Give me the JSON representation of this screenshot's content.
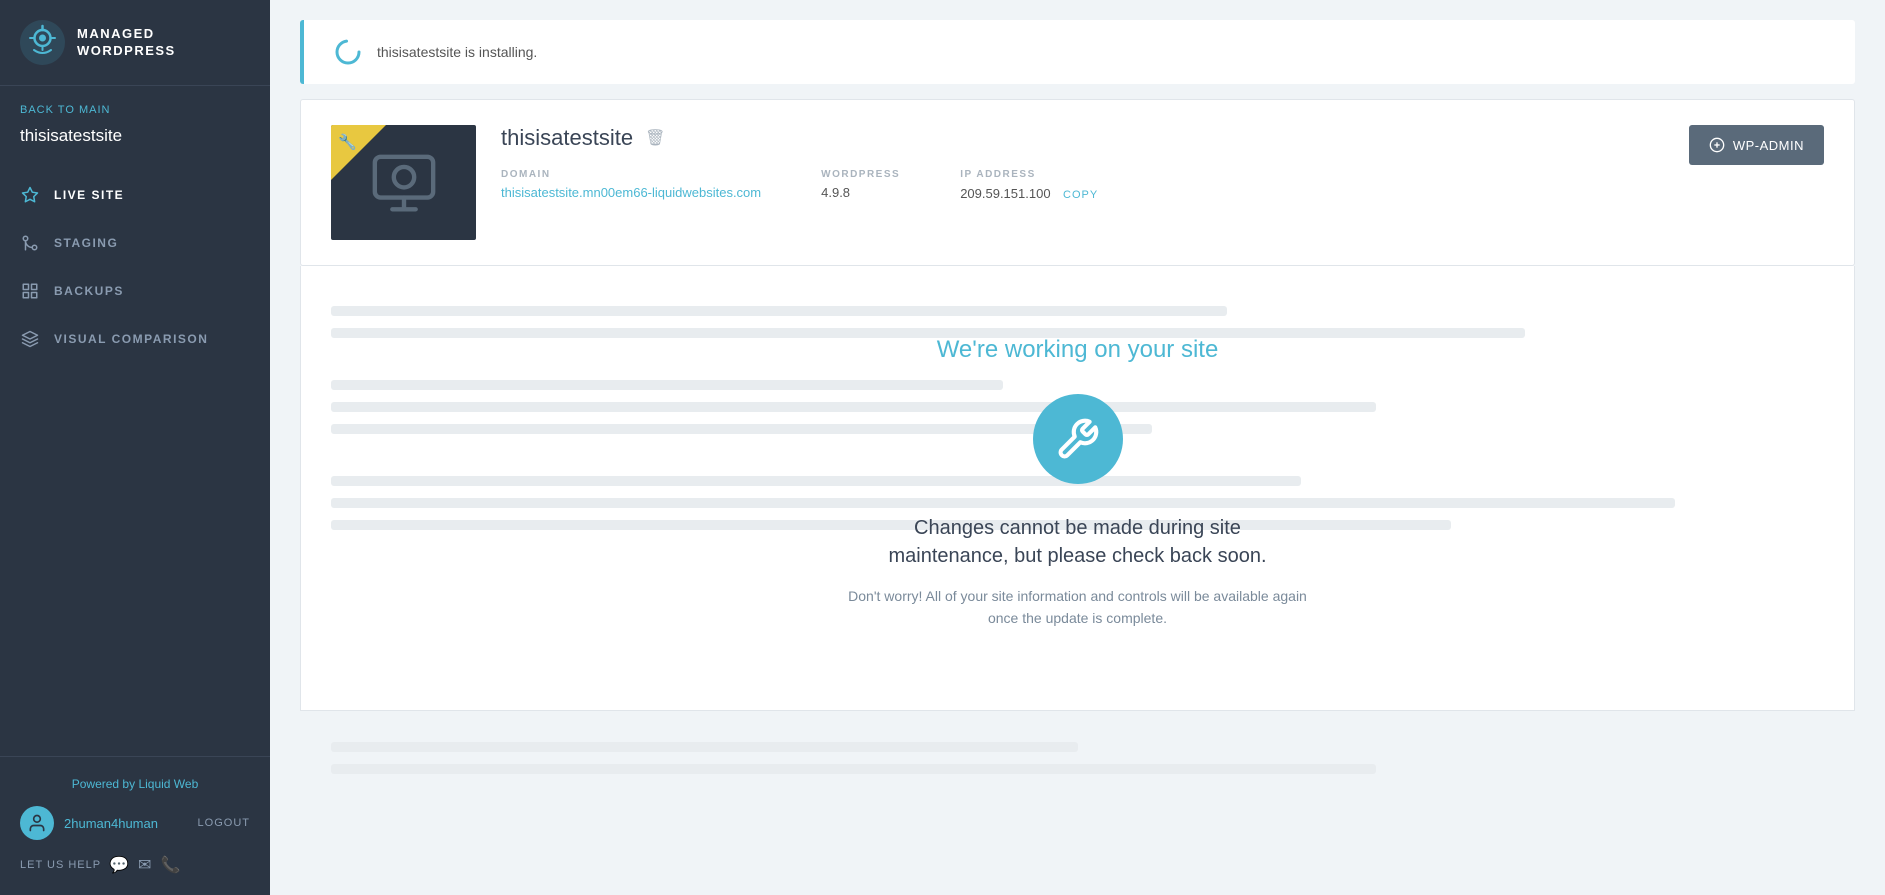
{
  "sidebar": {
    "logo": {
      "line1": "MANAGED",
      "line2": "WORDPRESS"
    },
    "back_label": "BACK TO MAIN",
    "current_site": "thisisatestsite",
    "nav_items": [
      {
        "id": "live-site",
        "label": "LIVE SITE",
        "active": true
      },
      {
        "id": "staging",
        "label": "STAGING",
        "active": false
      },
      {
        "id": "backups",
        "label": "BACKUPS",
        "active": false
      },
      {
        "id": "visual-comparison",
        "label": "VISUAL COMPARISON",
        "active": false
      }
    ],
    "powered_by": "Powered by Liquid Web",
    "user": {
      "name": "2human4human",
      "logout": "LOGOUT"
    },
    "let_us_help": "LET US HELP"
  },
  "header": {
    "installing_text": "thisisatestsite is installing."
  },
  "site": {
    "name": "thisisatestsite",
    "wp_admin_label": "WP-ADMIN",
    "domain_label": "DOMAIN",
    "domain_value": "thisisatestsite.mn00em66-liquidwebsites.com",
    "wordpress_label": "WORDPRESS",
    "wordpress_version": "4.9.8",
    "ip_label": "IP ADDRESS",
    "ip_value": "209.59.151.100",
    "ip_copy": "COPY"
  },
  "maintenance": {
    "title": "We're working on your site",
    "main_text": "Changes cannot be made during site maintenance, but please check back soon.",
    "sub_text": "Don't worry! All of your site information and controls will be available again once the update is complete."
  },
  "colors": {
    "accent": "#4db8d4",
    "sidebar_bg": "#2b3543",
    "text_dark": "#3a4556"
  }
}
